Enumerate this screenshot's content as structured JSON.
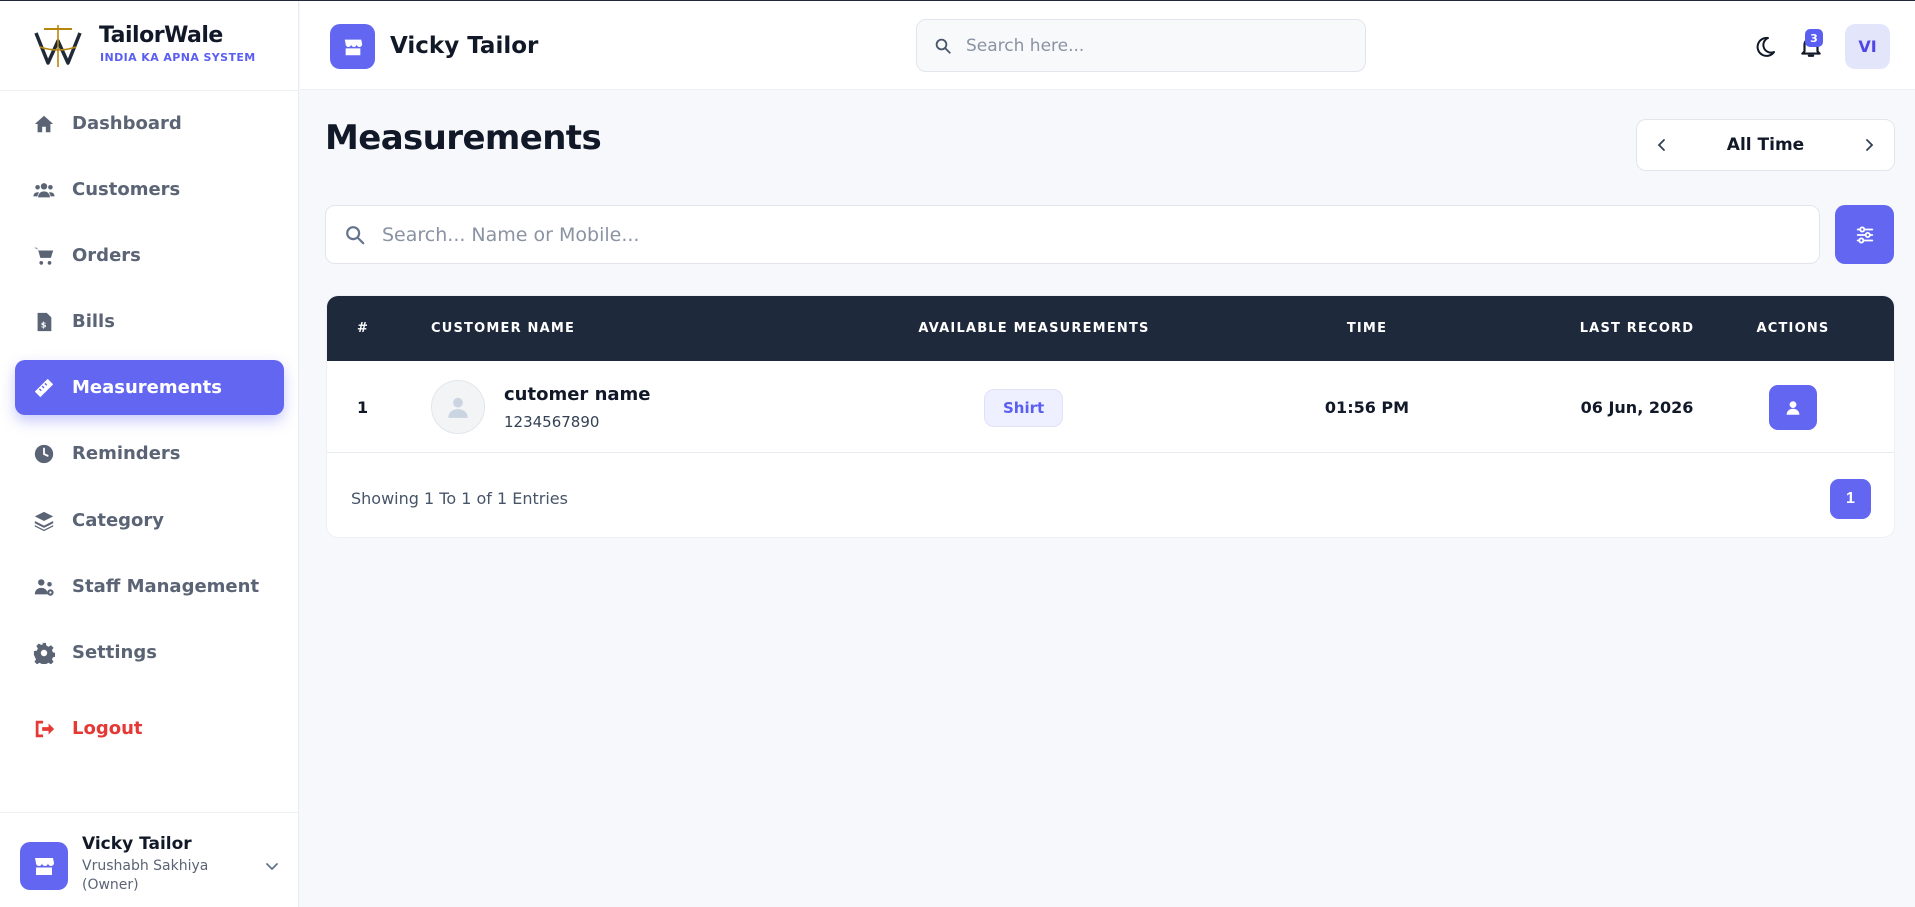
{
  "brand": {
    "name": "TailorWale",
    "tagline": "INDIA KA APNA SYSTEM"
  },
  "sidebar": {
    "items": [
      {
        "label": "Dashboard",
        "icon": "home-icon"
      },
      {
        "label": "Customers",
        "icon": "users-icon"
      },
      {
        "label": "Orders",
        "icon": "cart-icon"
      },
      {
        "label": "Bills",
        "icon": "invoice-icon"
      },
      {
        "label": "Measurements",
        "icon": "ruler-icon",
        "active": true
      },
      {
        "label": "Reminders",
        "icon": "clock-icon"
      },
      {
        "label": "Category",
        "icon": "layers-icon"
      },
      {
        "label": "Staff Management",
        "icon": "staff-icon"
      },
      {
        "label": "Settings",
        "icon": "gear-icon"
      },
      {
        "label": "Logout",
        "icon": "logout-icon"
      }
    ]
  },
  "account": {
    "shop": "Vicky Tailor",
    "owner": "Vrushabh Sakhiya (Owner)"
  },
  "header": {
    "shop_name": "Vicky Tailor",
    "search_placeholder": "Search here...",
    "notification_count": "3",
    "avatar_initials": "VI"
  },
  "main": {
    "title": "Measurements",
    "range_label": "All Time",
    "search_placeholder": "Search... Name or Mobile..."
  },
  "table": {
    "columns": [
      "#",
      "CUSTOMER NAME",
      "AVAILABLE MEASUREMENTS",
      "TIME",
      "LAST RECORD",
      "ACTIONS"
    ],
    "rows": [
      {
        "index": "1",
        "name": "cutomer name",
        "mobile": "1234567890",
        "measurement": "Shirt",
        "time": "01:56 PM",
        "last_record": "06 Jun, 2026"
      }
    ],
    "entries_text": "Showing 1 To 1 of 1 Entries",
    "current_page": "1"
  },
  "colors": {
    "accent": "#6366f1",
    "header_dark": "#1e293b",
    "logout": "#e53935",
    "text_muted": "#5b6475"
  }
}
